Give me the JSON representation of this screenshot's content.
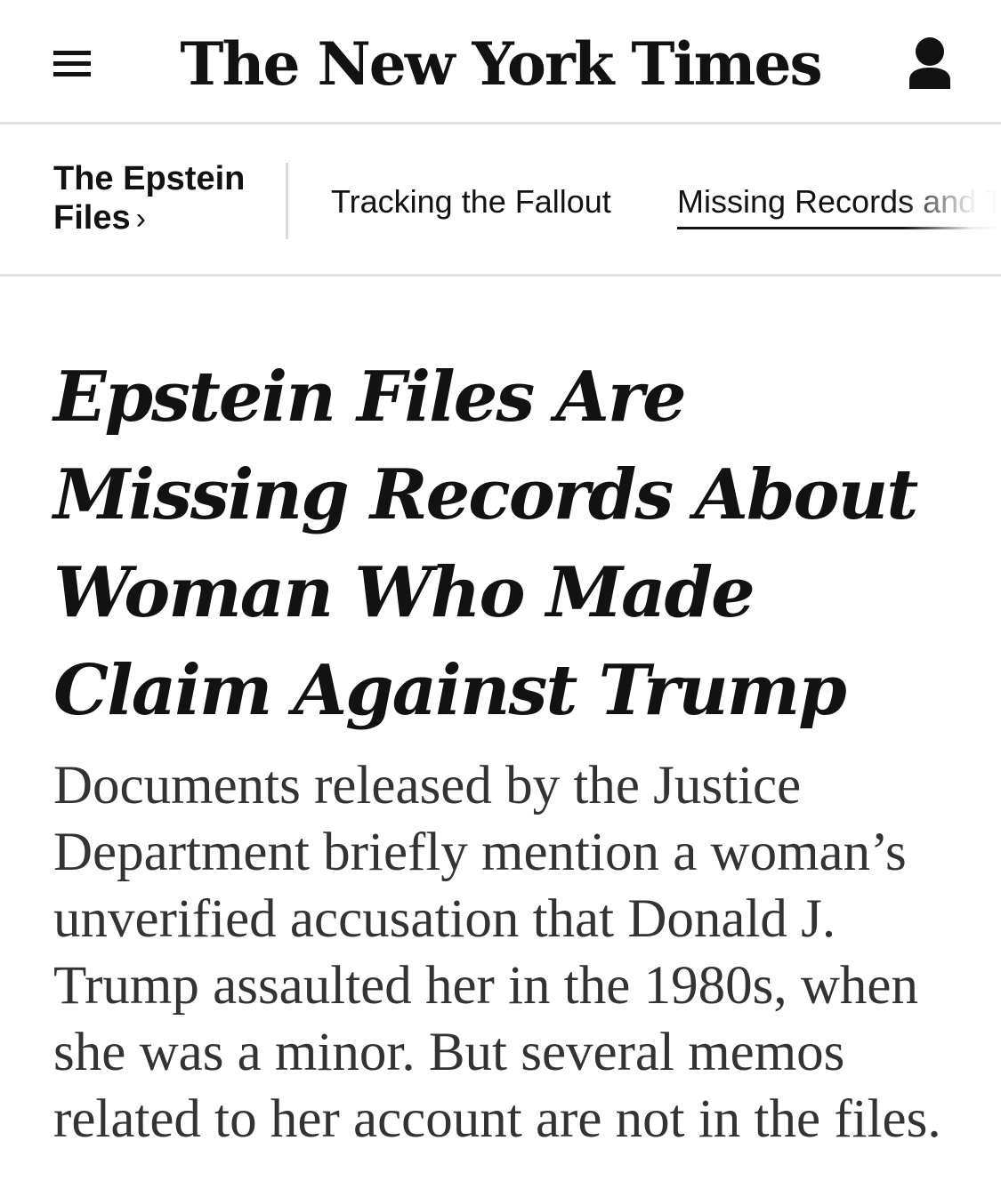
{
  "header": {
    "logo_text": "The New York Times",
    "menu_icon": "hamburger-menu-icon",
    "account_icon": "user-account-icon"
  },
  "section_nav": {
    "section_title": "The Epstein Files",
    "section_chevron": "›",
    "links": [
      {
        "label": "Tracking the Fallout",
        "selected": false
      },
      {
        "label": "Missing Records and T",
        "selected": true
      }
    ]
  },
  "article": {
    "headline": "Epstein Files Are Missing Records About Woman Who Made Claim Against Trump",
    "summary": "Documents released by the Justice Department briefly mention a woman’s unverified accusation that Donald J. Trump assaulted her in the 1980s, when she was a minor. But several memos related to her account are not in the files."
  },
  "colors": {
    "text": "#121212",
    "summary_text": "#333333",
    "divider": "#e2e2e2",
    "background": "#ffffff"
  }
}
